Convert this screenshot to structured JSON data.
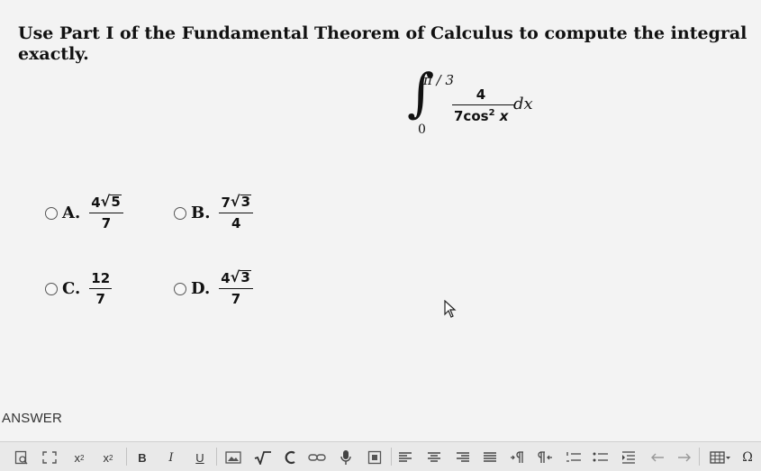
{
  "question": "Use Part I of the Fundamental Theorem of Calculus to compute the integral exactly.",
  "integral": {
    "upper_limit": "π / 3",
    "lower_limit": "0",
    "numerator": "4",
    "denominator_coef": "7cos",
    "denominator_exp": "2",
    "denominator_var": " x",
    "differential": "dx"
  },
  "choices": [
    {
      "letter": "A.",
      "num_coef": "4",
      "radicand": "5",
      "den": "7"
    },
    {
      "letter": "B.",
      "num_coef": "7",
      "radicand": "3",
      "den": "4"
    },
    {
      "letter": "C.",
      "num": "12",
      "den": "7"
    },
    {
      "letter": "D.",
      "num_coef": "4",
      "radicand": "3",
      "den": "7"
    }
  ],
  "answer_label": "ANSWER",
  "toolbar": {
    "subscript": "x",
    "subscript_mark": "2",
    "superscript": "x",
    "superscript_mark": "2",
    "bold": "B",
    "italic": "I",
    "underline": "U",
    "omega": "Ω"
  }
}
